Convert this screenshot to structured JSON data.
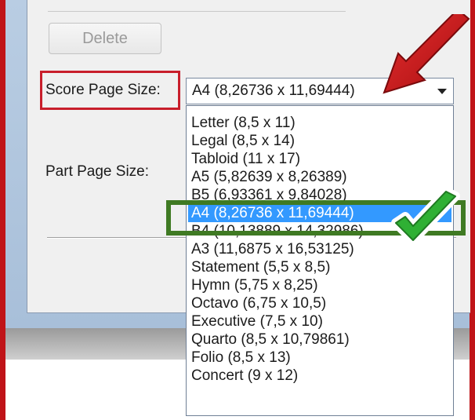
{
  "toolbar": {
    "delete_label": "Delete"
  },
  "score_page_size": {
    "label": "Score Page Size:",
    "selected": "A4 (8,26736 x 11,69444)"
  },
  "part_page_size": {
    "label": "Part Page Size:"
  },
  "dropdown": {
    "options": [
      "Letter (8,5 x 11)",
      "Legal (8,5 x 14)",
      "Tabloid (11 x 17)",
      "A5 (5,82639 x 8,26389)",
      "B5 (6,93361 x 9,84028)",
      "A4 (8,26736 x 11,69444)",
      "B4 (10,13889 x 14,32986)",
      "A3 (11,6875 x 16,53125)",
      "Statement (5,5 x 8,5)",
      "Hymn (5,75 x 8,25)",
      "Octavo (6,75 x 10,5)",
      "Executive (7,5 x 10)",
      "Quarto (8,5 x 10,79861)",
      "Folio (8,5 x 13)",
      "Concert (9 x 12)"
    ],
    "selected_index": 5
  },
  "icons": [
    "arrow-pointer-icon",
    "checkmark-icon",
    "chevron-down-icon"
  ],
  "colors": {
    "selection": "#3399ff",
    "annotation_red": "#c81e2b",
    "annotation_green": "#3f7a23",
    "check_green": "#2fb034"
  }
}
